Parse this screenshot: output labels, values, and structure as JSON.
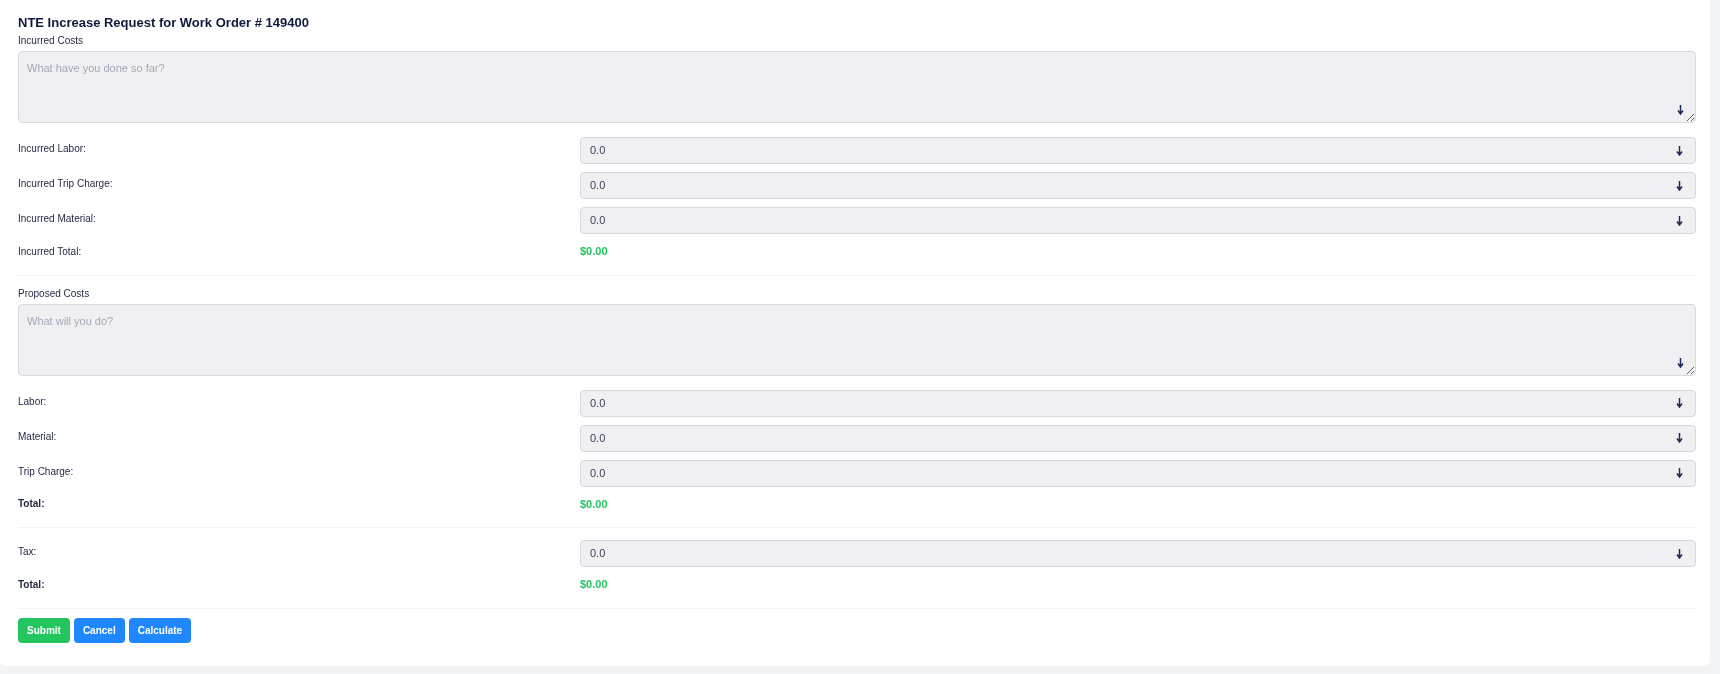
{
  "title": "NTE Increase Request for Work Order # 149400",
  "sections": [
    {
      "heading": "Incurred Costs",
      "placeholder": "What have you done so far?",
      "rows": [
        {
          "kind": "input",
          "label": "Incurred Labor:",
          "value": "0.0"
        },
        {
          "kind": "input",
          "label": "Incurred Trip Charge:",
          "value": "0.0"
        },
        {
          "kind": "input",
          "label": "Incurred Material:",
          "value": "0.0"
        },
        {
          "kind": "total",
          "label": "Incurred Total:",
          "value": "$0.00",
          "bold": false
        }
      ]
    },
    {
      "heading": "Proposed Costs",
      "placeholder": "What will you do?",
      "rows": [
        {
          "kind": "input",
          "label": "Labor:",
          "value": "0.0"
        },
        {
          "kind": "input",
          "label": "Material:",
          "value": "0.0"
        },
        {
          "kind": "input",
          "label": "Trip Charge:",
          "value": "0.0"
        },
        {
          "kind": "total",
          "label": "Total:",
          "value": "$0.00",
          "bold": true
        }
      ]
    },
    {
      "rows": [
        {
          "kind": "input",
          "label": "Tax:",
          "value": "0.0"
        },
        {
          "kind": "total",
          "label": "Total:",
          "value": "$0.00",
          "bold": true
        }
      ]
    }
  ],
  "buttons": [
    {
      "label": "Submit",
      "kind": "success"
    },
    {
      "label": "Cancel",
      "kind": "primary"
    },
    {
      "label": "Calculate",
      "kind": "primary"
    }
  ]
}
